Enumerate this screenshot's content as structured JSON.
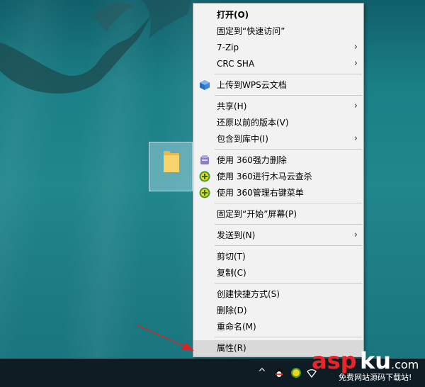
{
  "menu": {
    "items": [
      {
        "label": "打开(O)",
        "bold": true
      },
      {
        "label": "固定到“快速访问”"
      },
      {
        "label": "7-Zip",
        "submenu": true
      },
      {
        "label": "CRC SHA",
        "submenu": true
      },
      {
        "label": "上传到WPS云文档",
        "icon": "wps-cloud-icon"
      },
      {
        "label": "共享(H)",
        "submenu": true
      },
      {
        "label": "还原以前的版本(V)"
      },
      {
        "label": "包含到库中(I)",
        "submenu": true
      },
      {
        "label": "使用 360强力删除",
        "icon": "360-shred-icon"
      },
      {
        "label": "使用 360进行木马云查杀",
        "icon": "360-scan-icon"
      },
      {
        "label": "使用 360管理右键菜单",
        "icon": "360-menu-icon"
      },
      {
        "label": "固定到“开始”屏幕(P)"
      },
      {
        "label": "发送到(N)",
        "submenu": true
      },
      {
        "label": "剪切(T)"
      },
      {
        "label": "复制(C)"
      },
      {
        "label": "创建快捷方式(S)"
      },
      {
        "label": "删除(D)"
      },
      {
        "label": "重命名(M)"
      },
      {
        "label": "属性(R)",
        "highlighted": true
      }
    ],
    "submenu_arrow": "›"
  },
  "taskbar": {
    "tray_caret": "^"
  },
  "watermark": {
    "logo": "aspku.com",
    "caption": "免费网站源码下载站!"
  },
  "colors": {
    "menu_bg": "#f2f2f2",
    "highlight": "#d9d9d9",
    "taskbar": "#101c24",
    "arrow": "#e02020"
  }
}
